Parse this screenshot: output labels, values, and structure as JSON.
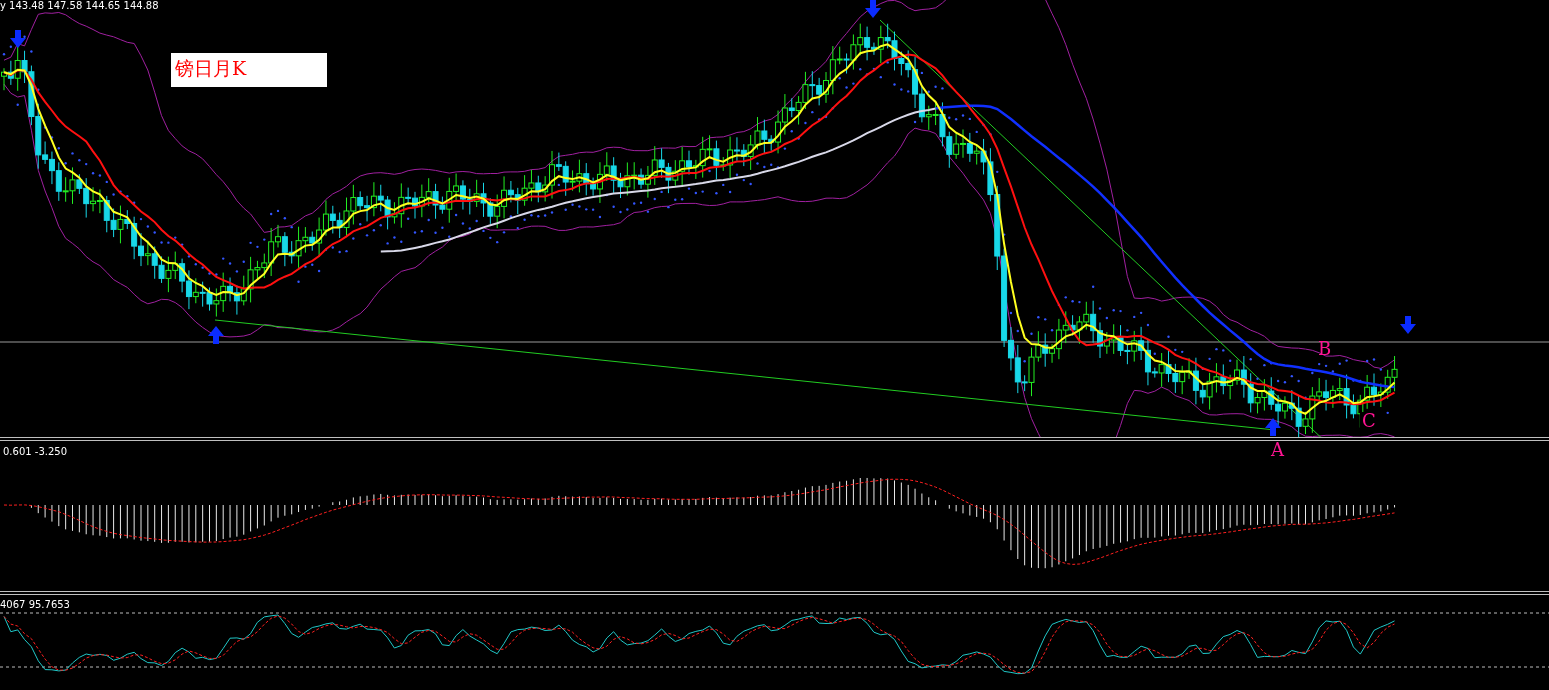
{
  "header": {
    "text": "y  143.48 147.58 144.65 144.88"
  },
  "chart_label": "镑日月K",
  "points": [
    {
      "label": "B"
    },
    {
      "label": "A"
    },
    {
      "label": "C"
    }
  ],
  "macd": {
    "reading": "0.601 -3.250"
  },
  "stochastic": {
    "reading": "4067 95.7653"
  }
}
